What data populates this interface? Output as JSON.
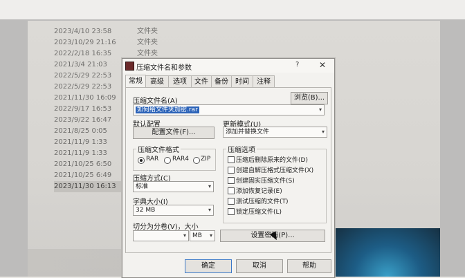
{
  "background_list": {
    "rows": [
      {
        "date": "2023/4/10 23:58",
        "type": "文件夹"
      },
      {
        "date": "2023/10/29 21:16",
        "type": "文件夹"
      },
      {
        "date": "2022/2/18 16:35",
        "type": "文件夹"
      },
      {
        "date": "2021/3/4 21:03",
        "type": "文件夹"
      },
      {
        "date": "2022/5/29 22:53",
        "type": ""
      },
      {
        "date": "2022/5/29 22:53",
        "type": ""
      },
      {
        "date": "2021/11/30 16:09",
        "type": ""
      },
      {
        "date": "2022/9/17 16:53",
        "type": ""
      },
      {
        "date": "2023/9/22 16:47",
        "type": ""
      },
      {
        "date": "2021/8/25 0:05",
        "type": ""
      },
      {
        "date": "2021/11/9 1:33",
        "type": ""
      },
      {
        "date": "2021/11/9 1:33",
        "type": ""
      },
      {
        "date": "2021/10/25 6:50",
        "type": ""
      },
      {
        "date": "2021/10/25 6:49",
        "type": ""
      },
      {
        "date": "2023/11/30 16:13",
        "type": ""
      }
    ]
  },
  "dialog": {
    "title": "压缩文件名和参数",
    "help": "?",
    "close": "✕",
    "tabs": [
      "常规",
      "高级",
      "选项",
      "文件",
      "备份",
      "时间",
      "注释"
    ],
    "archive_name_label": "压缩文件名(A)",
    "browse_button": "浏览(B)...",
    "archive_name_value": "如何给文件夹加密.rar",
    "default_profile_label": "默认配置",
    "profiles_button": "配置文件(F)...",
    "update_mode_label": "更新模式(U)",
    "update_mode_value": "添加并替换文件",
    "format_group_title": "压缩文件格式",
    "formats": [
      {
        "label": "RAR",
        "checked": true
      },
      {
        "label": "RAR4",
        "checked": false
      },
      {
        "label": "ZIP",
        "checked": false
      }
    ],
    "method_label": "压缩方式(C)",
    "method_value": "标准",
    "dict_label": "字典大小(I)",
    "dict_value": "32 MB",
    "split_label": "切分为分卷(V)，大小",
    "split_value": "",
    "split_unit": "MB",
    "options_group_title": "压缩选项",
    "options": [
      "压缩后删除原来的文件(D)",
      "创建自解压格式压缩文件(X)",
      "创建固实压缩文件(S)",
      "添加恢复记录(E)",
      "测试压缩的文件(T)",
      "锁定压缩文件(L)"
    ],
    "password_button": "设置密码(P)...",
    "ok_button": "确定",
    "cancel_button": "取消",
    "help_button": "帮助"
  },
  "colors": {
    "selection": "#2c63b8",
    "taskbar_glow": "#3aa0c8"
  }
}
